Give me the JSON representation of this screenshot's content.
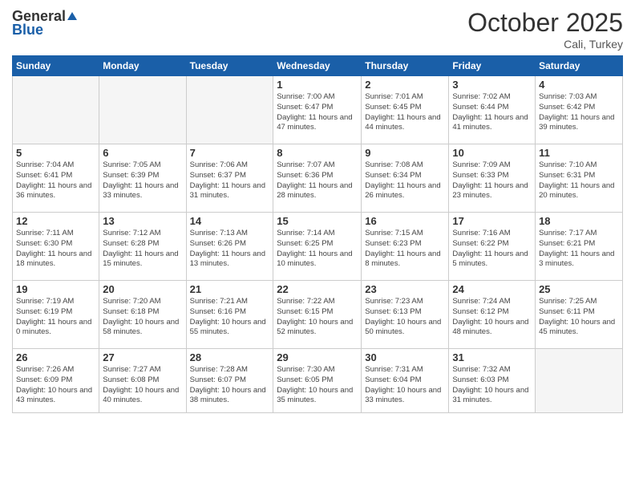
{
  "header": {
    "logo_general": "General",
    "logo_blue": "Blue",
    "month_title": "October 2025",
    "location": "Cali, Turkey"
  },
  "days_of_week": [
    "Sunday",
    "Monday",
    "Tuesday",
    "Wednesday",
    "Thursday",
    "Friday",
    "Saturday"
  ],
  "weeks": [
    [
      {
        "day": "",
        "empty": true
      },
      {
        "day": "",
        "empty": true
      },
      {
        "day": "",
        "empty": true
      },
      {
        "day": "1",
        "sunrise": "7:00 AM",
        "sunset": "6:47 PM",
        "daylight": "11 hours and 47 minutes."
      },
      {
        "day": "2",
        "sunrise": "7:01 AM",
        "sunset": "6:45 PM",
        "daylight": "11 hours and 44 minutes."
      },
      {
        "day": "3",
        "sunrise": "7:02 AM",
        "sunset": "6:44 PM",
        "daylight": "11 hours and 41 minutes."
      },
      {
        "day": "4",
        "sunrise": "7:03 AM",
        "sunset": "6:42 PM",
        "daylight": "11 hours and 39 minutes."
      }
    ],
    [
      {
        "day": "5",
        "sunrise": "7:04 AM",
        "sunset": "6:41 PM",
        "daylight": "11 hours and 36 minutes."
      },
      {
        "day": "6",
        "sunrise": "7:05 AM",
        "sunset": "6:39 PM",
        "daylight": "11 hours and 33 minutes."
      },
      {
        "day": "7",
        "sunrise": "7:06 AM",
        "sunset": "6:37 PM",
        "daylight": "11 hours and 31 minutes."
      },
      {
        "day": "8",
        "sunrise": "7:07 AM",
        "sunset": "6:36 PM",
        "daylight": "11 hours and 28 minutes."
      },
      {
        "day": "9",
        "sunrise": "7:08 AM",
        "sunset": "6:34 PM",
        "daylight": "11 hours and 26 minutes."
      },
      {
        "day": "10",
        "sunrise": "7:09 AM",
        "sunset": "6:33 PM",
        "daylight": "11 hours and 23 minutes."
      },
      {
        "day": "11",
        "sunrise": "7:10 AM",
        "sunset": "6:31 PM",
        "daylight": "11 hours and 20 minutes."
      }
    ],
    [
      {
        "day": "12",
        "sunrise": "7:11 AM",
        "sunset": "6:30 PM",
        "daylight": "11 hours and 18 minutes."
      },
      {
        "day": "13",
        "sunrise": "7:12 AM",
        "sunset": "6:28 PM",
        "daylight": "11 hours and 15 minutes."
      },
      {
        "day": "14",
        "sunrise": "7:13 AM",
        "sunset": "6:26 PM",
        "daylight": "11 hours and 13 minutes."
      },
      {
        "day": "15",
        "sunrise": "7:14 AM",
        "sunset": "6:25 PM",
        "daylight": "11 hours and 10 minutes."
      },
      {
        "day": "16",
        "sunrise": "7:15 AM",
        "sunset": "6:23 PM",
        "daylight": "11 hours and 8 minutes."
      },
      {
        "day": "17",
        "sunrise": "7:16 AM",
        "sunset": "6:22 PM",
        "daylight": "11 hours and 5 minutes."
      },
      {
        "day": "18",
        "sunrise": "7:17 AM",
        "sunset": "6:21 PM",
        "daylight": "11 hours and 3 minutes."
      }
    ],
    [
      {
        "day": "19",
        "sunrise": "7:19 AM",
        "sunset": "6:19 PM",
        "daylight": "11 hours and 0 minutes."
      },
      {
        "day": "20",
        "sunrise": "7:20 AM",
        "sunset": "6:18 PM",
        "daylight": "10 hours and 58 minutes."
      },
      {
        "day": "21",
        "sunrise": "7:21 AM",
        "sunset": "6:16 PM",
        "daylight": "10 hours and 55 minutes."
      },
      {
        "day": "22",
        "sunrise": "7:22 AM",
        "sunset": "6:15 PM",
        "daylight": "10 hours and 52 minutes."
      },
      {
        "day": "23",
        "sunrise": "7:23 AM",
        "sunset": "6:13 PM",
        "daylight": "10 hours and 50 minutes."
      },
      {
        "day": "24",
        "sunrise": "7:24 AM",
        "sunset": "6:12 PM",
        "daylight": "10 hours and 48 minutes."
      },
      {
        "day": "25",
        "sunrise": "7:25 AM",
        "sunset": "6:11 PM",
        "daylight": "10 hours and 45 minutes."
      }
    ],
    [
      {
        "day": "26",
        "sunrise": "7:26 AM",
        "sunset": "6:09 PM",
        "daylight": "10 hours and 43 minutes."
      },
      {
        "day": "27",
        "sunrise": "7:27 AM",
        "sunset": "6:08 PM",
        "daylight": "10 hours and 40 minutes."
      },
      {
        "day": "28",
        "sunrise": "7:28 AM",
        "sunset": "6:07 PM",
        "daylight": "10 hours and 38 minutes."
      },
      {
        "day": "29",
        "sunrise": "7:30 AM",
        "sunset": "6:05 PM",
        "daylight": "10 hours and 35 minutes."
      },
      {
        "day": "30",
        "sunrise": "7:31 AM",
        "sunset": "6:04 PM",
        "daylight": "10 hours and 33 minutes."
      },
      {
        "day": "31",
        "sunrise": "7:32 AM",
        "sunset": "6:03 PM",
        "daylight": "10 hours and 31 minutes."
      },
      {
        "day": "",
        "empty": true
      }
    ]
  ]
}
